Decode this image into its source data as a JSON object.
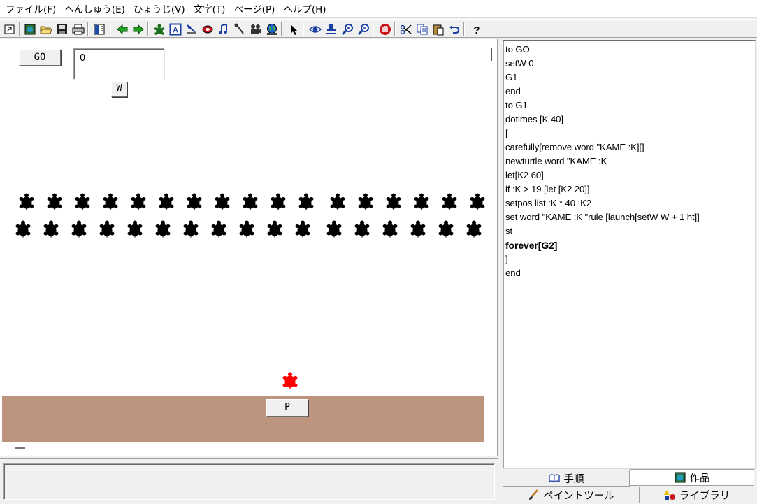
{
  "menu": {
    "items": [
      {
        "label": "ファイル(F)"
      },
      {
        "label": "へんしゅう(E)"
      },
      {
        "label": "ひょうじ(V)"
      },
      {
        "label": "文字(T)"
      },
      {
        "label": "ページ(P)"
      },
      {
        "label": "ヘルプ(H)"
      }
    ]
  },
  "toolbar": {
    "buttons": [
      {
        "icon": "restore-icon"
      },
      {
        "icon": "new-page-icon"
      },
      {
        "icon": "open-folder-icon"
      },
      {
        "icon": "save-icon"
      },
      {
        "icon": "print-icon"
      },
      {
        "icon": "page-layout-icon"
      },
      {
        "icon": "back-arrow-icon"
      },
      {
        "icon": "forward-arrow-icon"
      },
      {
        "icon": "new-turtle-icon"
      },
      {
        "icon": "text-box-icon"
      },
      {
        "icon": "slider-icon"
      },
      {
        "icon": "button-icon"
      },
      {
        "icon": "music-icon"
      },
      {
        "icon": "sound-icon"
      },
      {
        "icon": "video-icon"
      },
      {
        "icon": "globe-icon"
      },
      {
        "icon": "pointer-icon"
      },
      {
        "icon": "eye-icon"
      },
      {
        "icon": "stamp-icon"
      },
      {
        "icon": "zoom-in-icon"
      },
      {
        "icon": "zoom-out-icon"
      },
      {
        "icon": "stop-hand-icon"
      },
      {
        "icon": "cut-icon"
      },
      {
        "icon": "copy-icon"
      },
      {
        "icon": "paste-icon"
      },
      {
        "icon": "undo-icon"
      },
      {
        "icon": "help-icon"
      }
    ]
  },
  "stage": {
    "go_button": "GO",
    "value_box": "0",
    "w_button": "W",
    "p_button": "P",
    "turtle_rows": [
      {
        "count": 17,
        "color": "#000000"
      },
      {
        "count": 17,
        "color": "#000000"
      }
    ],
    "active_turtle_color": "#ff0000",
    "ground_color": "#bd957e"
  },
  "procedures": {
    "lines": [
      {
        "text": "to GO",
        "bold": false
      },
      {
        "text": "setW 0",
        "bold": false
      },
      {
        "text": "G1",
        "bold": false
      },
      {
        "text": "end",
        "bold": false
      },
      {
        "text": "to G1",
        "bold": false
      },
      {
        "text": "dotimes [K 40]",
        "bold": false
      },
      {
        "text": "[",
        "bold": false
      },
      {
        "text": "carefully[remove word \"KAME :K][]",
        "bold": false
      },
      {
        "text": "newturtle word \"KAME :K",
        "bold": false
      },
      {
        "text": "let[K2 60]",
        "bold": false
      },
      {
        "text": "if :K > 19 [let [K2 20]]",
        "bold": false
      },
      {
        "text": "setpos list :K * 40 :K2",
        "bold": false
      },
      {
        "text": "set word \"KAME :K \"rule [launch[setW W + 1 ht]]",
        "bold": false
      },
      {
        "text": "st",
        "bold": false
      },
      {
        "text": "forever[G2]",
        "bold": true
      },
      {
        "text": "]",
        "bold": false
      },
      {
        "text": "end",
        "bold": false
      }
    ]
  },
  "tabs": {
    "procedures": "手順",
    "project": "作品",
    "paint_tools": "ペイントツール",
    "library": "ライブラリ"
  }
}
